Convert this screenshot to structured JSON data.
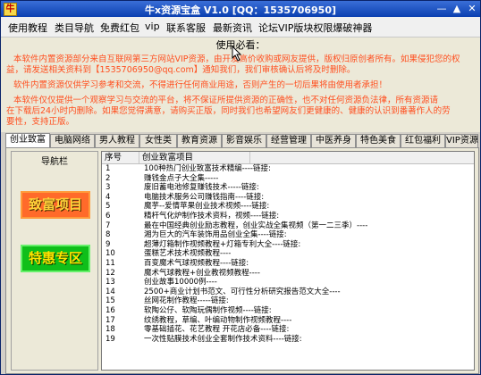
{
  "title": "牛x资源宝盒 V1.0 [QQ：1535706950]",
  "window_buttons": {
    "minimize": "—",
    "maximize": "▲",
    "close": "✕"
  },
  "menu": [
    "使用教程",
    "类目导航",
    "免费红包",
    "vip",
    "联系客服",
    "最新资讯",
    "论坛VIP版块权限爆破神器"
  ],
  "notice": {
    "title": "使用必看：",
    "lines": [
      "本软件内置资源部分来自互联网第三方网站VIP资源，由开发高价收购或网友提供，版权归原创者所有。如果侵犯您的权",
      "益，请发送相关资料到【1535706950@qq.com】通知我们，我们审核确认后将及时删除。",
      "软件内置资源仅供学习参考和交流，不得进行任何商业用途，否则产生的一切后果将由使用者承担！",
      "本软件仅仅提供一个观察学习与交流的平台，将不保证所提供资源的正确性，也不对任何资源负法律，所有资源请",
      "在下载后24小时内删除。如果您觉得满意，请购买正版，同时我们也希望网友们更健康的、健康的认识到番著作人的劳",
      "要性，支持正版。"
    ]
  },
  "tabs": [
    "创业致富",
    "电脑网络",
    "男人教程",
    "女性类",
    "教育资源",
    "影音娱乐",
    "经营管理",
    "中医养身",
    "特色美食",
    "红包福利",
    "VIP资源"
  ],
  "nav": {
    "title": "导航栏",
    "buttons": [
      "致富项目",
      "特惠专区"
    ]
  },
  "list": {
    "headers": [
      "序号",
      "创业致富项目"
    ],
    "rows": [
      {
        "num": "1",
        "name": "100种热门创业致富技术精编----链接:"
      },
      {
        "num": "2",
        "name": "赚钱金点子大全集-----"
      },
      {
        "num": "3",
        "name": "废旧蓄电池修复赚钱技术-----链接:"
      },
      {
        "num": "4",
        "name": "电脑技术服务公司赚钱指南----链接:"
      },
      {
        "num": "5",
        "name": "魔芋--爱情苹果创业技术视频----链接:"
      },
      {
        "num": "6",
        "name": "精杆气化炉制作技术资料，视频----链接:"
      },
      {
        "num": "7",
        "name": "最在中国经典创业励志教程，创业实战全集视频（第一二三季）----"
      },
      {
        "num": "8",
        "name": "湘为巨大的汽车装饰用品创业全集----链接:"
      },
      {
        "num": "9",
        "name": "超薄灯箱制作视频教程+灯箱专利大全----链接:"
      },
      {
        "num": "10",
        "name": "蛋糕艺术技术视频教程----"
      },
      {
        "num": "11",
        "name": "百变魔术气球视频教程----链接:"
      },
      {
        "num": "12",
        "name": "魔术气球教程+创业教视频教程----"
      },
      {
        "num": "13",
        "name": "创业故事10000例----"
      },
      {
        "num": "14",
        "name": "2500+商业计划书范文、可行性分析研究报告范文大全----"
      },
      {
        "num": "15",
        "name": "丝网花制作教程-----链接:"
      },
      {
        "num": "16",
        "name": "软陶公仔、软陶玩偶制作视频----链接:"
      },
      {
        "num": "17",
        "name": "纹绣教程，草编、叶编动物制作视频教程----"
      },
      {
        "num": "18",
        "name": "零基础插花、花艺教程 开花店必备----链接:"
      },
      {
        "num": "19",
        "name": "一次性贴膜技术创业全套制作技术资料----链接:"
      }
    ]
  }
}
